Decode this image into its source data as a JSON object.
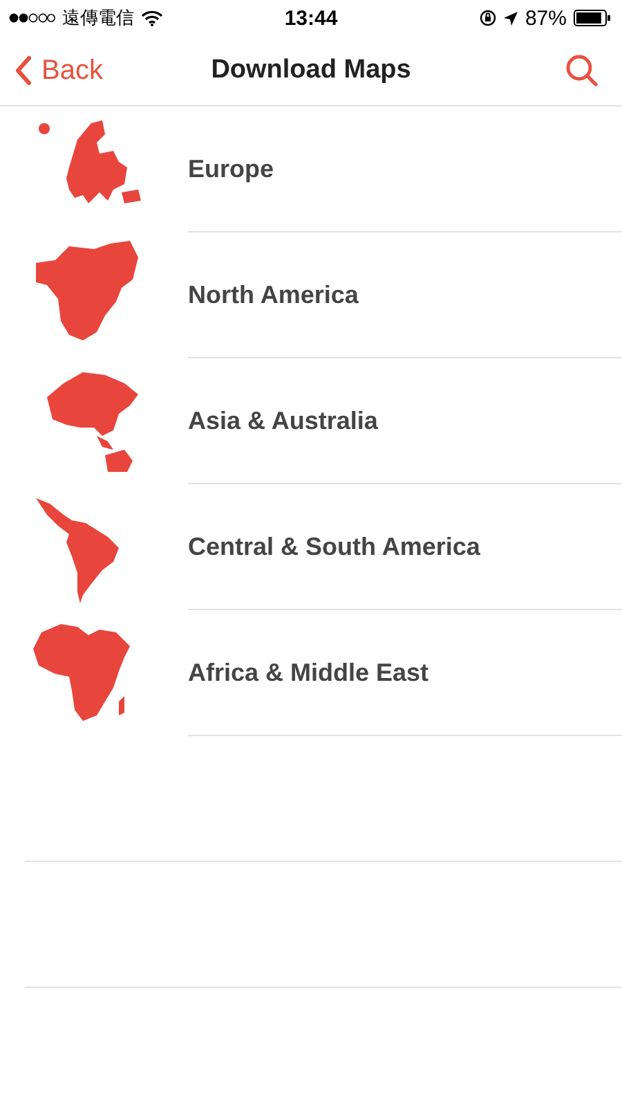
{
  "status_bar": {
    "carrier": "遠傳電信",
    "time": "13:44",
    "battery": "87%"
  },
  "nav_bar": {
    "back": "Back",
    "title": "Download Maps"
  },
  "regions": [
    {
      "name": "Europe",
      "kind": "europe"
    },
    {
      "name": "North America",
      "kind": "northamerica"
    },
    {
      "name": "Asia & Australia",
      "kind": "asia"
    },
    {
      "name": "Central & South America",
      "kind": "southamerica"
    },
    {
      "name": "Africa & Middle East",
      "kind": "africa"
    }
  ]
}
